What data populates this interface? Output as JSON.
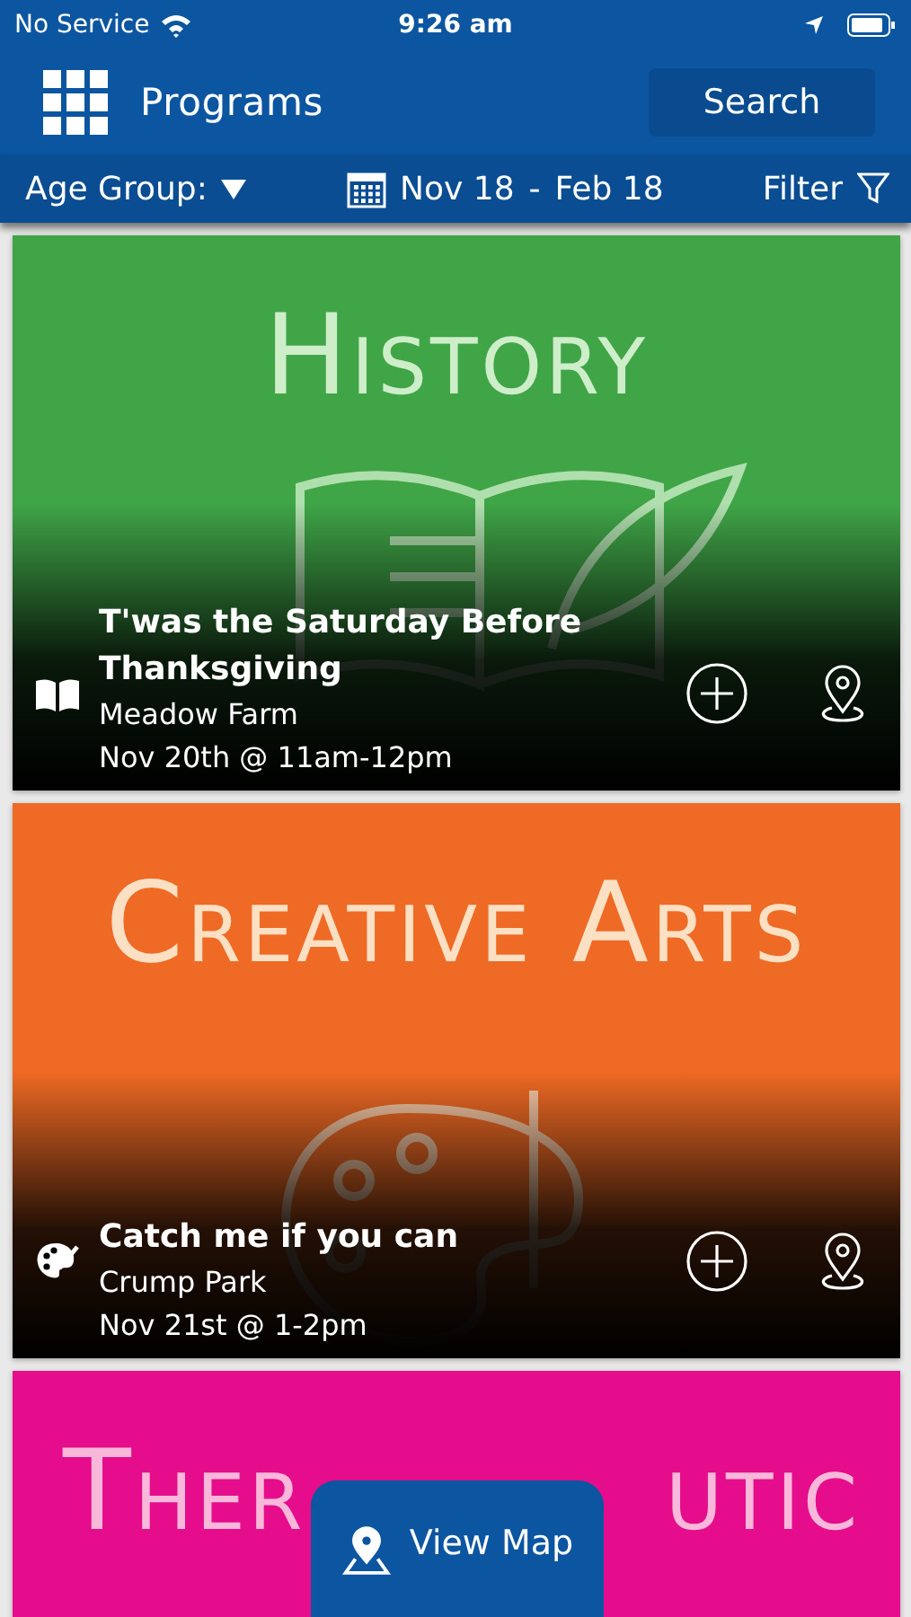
{
  "status_bar": {
    "carrier": "No Service",
    "time": "9:26 am"
  },
  "header": {
    "title": "Programs",
    "search_button": "Search"
  },
  "filter_bar": {
    "age_group": "Age Group:",
    "date_from": "Nov 18",
    "date_separator": "-",
    "date_to": "Feb 18",
    "filter": "Filter"
  },
  "cards": [
    {
      "kind": "book",
      "color": "#3fa547",
      "banner_title": "History",
      "title": "T'was the Saturday Before Thanksgiving",
      "location": "Meadow Farm",
      "when": "Nov 20th @ 11am-12pm"
    },
    {
      "kind": "palette",
      "color": "#ef6a24",
      "banner_title": "Creative Arts",
      "title": "Catch me if you can",
      "location": "Crump Park",
      "when": "Nov 21st @ 1-2pm"
    },
    {
      "kind": "none",
      "color": "#e50d8c",
      "banner_parts": [
        "Ther",
        "utic"
      ]
    }
  ],
  "view_map_button": "View Map"
}
